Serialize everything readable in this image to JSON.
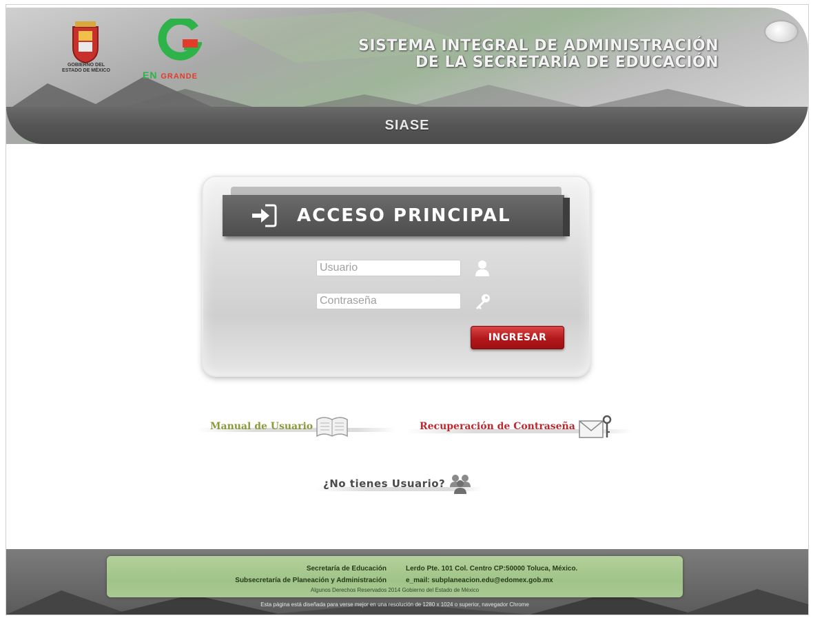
{
  "header": {
    "system_title_line1": "SISTEMA INTEGRAL  DE ADMINISTRACIÓN",
    "system_title_line2": "DE LA SECRETARÍA DE EDUCACIÓN",
    "app_name": "SIASE",
    "gov_logo_text_line1": "GOBIERNO DEL",
    "gov_logo_text_line2": "ESTADO DE MÉXICO",
    "campaign_en": "EN",
    "campaign_grande": "GRANDE"
  },
  "login": {
    "title": "ACCESO PRINCIPAL",
    "user_placeholder": "Usuario",
    "password_placeholder": "Contraseña",
    "submit_label": "INGRESAR"
  },
  "links": {
    "manual": "Manual de Usuario",
    "recovery": "Recuperación de Contraseña",
    "no_user": "¿No tienes Usuario?"
  },
  "footer": {
    "dept": "Secretaría de Educación",
    "subdept": "Subsecretaría de Planeación y Administración",
    "address": "Lerdo Pte. 101 Col. Centro CP:50000 Toluca, México.",
    "email": "e_mail: subplaneacion.edu@edomex.gob.mx",
    "rights": "Algunos Derechos Reservados 2014 Gobierno del Estado de México",
    "notice": "Esta página está diseñada para verse mejor en una resolución de 1280 x 1024 o superior, navegador Chrome"
  },
  "colors": {
    "brand_green": "#2db34a",
    "brand_red": "#e23b2a",
    "button_red": "#b3181b",
    "header_gray": "#555555"
  }
}
